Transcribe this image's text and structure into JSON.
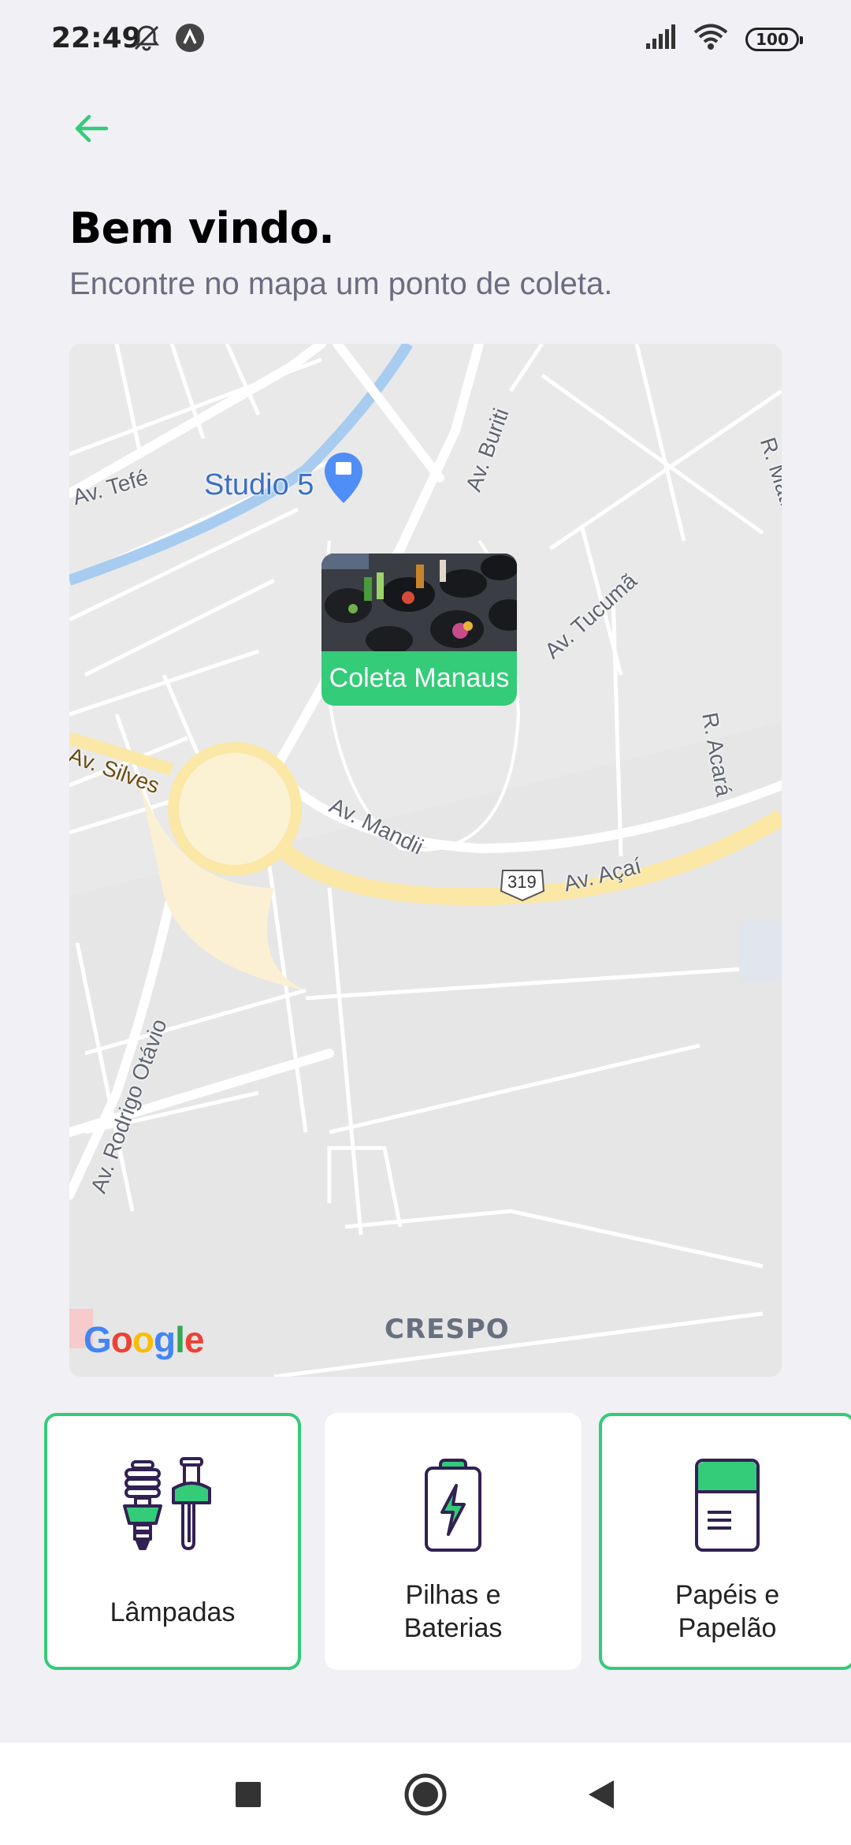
{
  "status_bar": {
    "time": "22:49",
    "left_icons": [
      "muted-bell-icon",
      "app-notification-icon"
    ],
    "right_icons": [
      "signal-icon",
      "wifi-icon",
      "battery-icon"
    ],
    "battery": "100"
  },
  "header": {
    "back_icon": "arrow-left-icon",
    "title": "Bem vindo.",
    "subtitle": "Encontre no mapa um ponto de coleta."
  },
  "map": {
    "poi": "Studio 5",
    "streets": {
      "av_tefe": "Av. Tefé",
      "av_buriti": "Av. Buriti",
      "r_matrinxa": "R. Matrinxã",
      "av_tucuma": "Av. Tucumã",
      "r_acara": "R. Acará",
      "av_silves": "Av. Silves",
      "av_mandii": "Av. Mandii",
      "av_acai": "Av. Açaí",
      "route": "319",
      "av_rodrigo_otavio": "Av. Rodrigo Otávio"
    },
    "district": "CRESPO",
    "logo": "Google",
    "marker": {
      "title": "Coleta Manaus"
    }
  },
  "items": [
    {
      "label": "Lâmpadas",
      "icon": "light-bulbs-icon",
      "selected": true
    },
    {
      "label": "Pilhas e Baterias",
      "icon": "battery-charge-icon",
      "selected": false
    },
    {
      "label": "Papéis e Papelão",
      "icon": "paper-icon",
      "selected": true
    }
  ],
  "colors": {
    "accent": "#34CB79",
    "dark": "#322153",
    "subtitle": "#6C6C80",
    "background": "#F0F0F5"
  },
  "nav": {
    "icons": [
      "recent-apps-icon",
      "home-icon",
      "back-icon"
    ]
  }
}
